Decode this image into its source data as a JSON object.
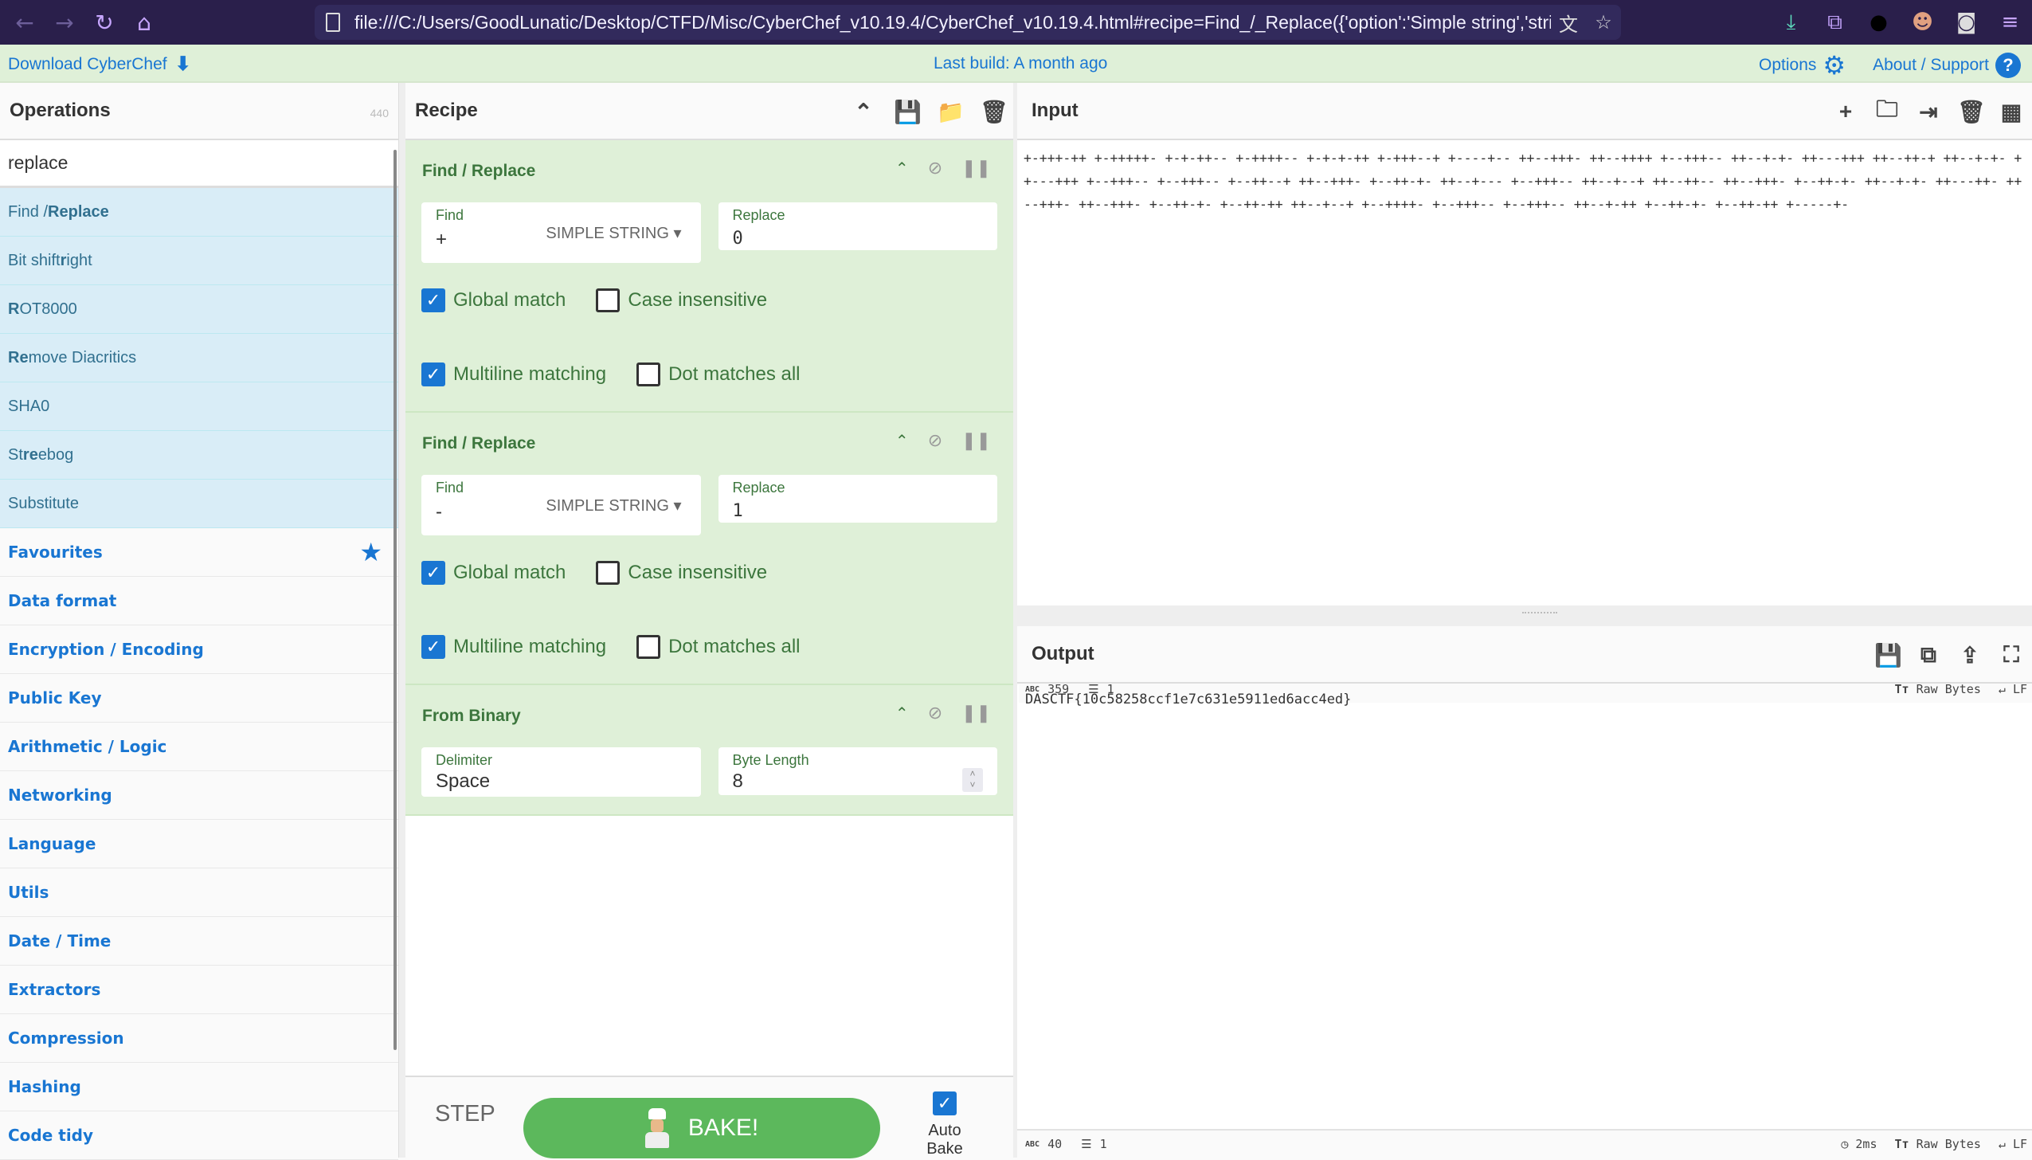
{
  "browser": {
    "url": "file:///C:/Users/GoodLunatic/Desktop/CTFD/Misc/CyberChef_v10.19.4/CyberChef_v10.19.4.html#recipe=Find_/_Replace({'option':'Simple string','string':'%",
    "back_icon": "arrow-left-icon",
    "forward_icon": "arrow-right-icon",
    "reload_icon": "reload-icon",
    "home_icon": "home-icon",
    "translate_icon": "translate-icon",
    "bookmark_icon": "star-outline-icon"
  },
  "banner": {
    "download_label": "Download CyberChef",
    "last_build": "Last build: A month ago",
    "options_label": "Options",
    "about_label": "About / Support"
  },
  "operations": {
    "title": "Operations",
    "count": "440",
    "search_value": "replace",
    "results": [
      {
        "pre": "Find / ",
        "bold": "Replace",
        "post": ""
      },
      {
        "pre": "Bit shift ",
        "bold": "r",
        "post": "ight"
      },
      {
        "pre": "",
        "bold": "R",
        "post": "OT8000"
      },
      {
        "pre": "",
        "bold": "Re",
        "post": "move Diacritics"
      },
      {
        "pre": "SHA0",
        "bold": "",
        "post": ""
      },
      {
        "pre": "St",
        "bold": "re",
        "post": "ebog"
      },
      {
        "pre": "Substitute",
        "bold": "",
        "post": ""
      }
    ],
    "categories": [
      "Favourites",
      "Data format",
      "Encryption / Encoding",
      "Public Key",
      "Arithmetic / Logic",
      "Networking",
      "Language",
      "Utils",
      "Date / Time",
      "Extractors",
      "Compression",
      "Hashing",
      "Code tidy"
    ]
  },
  "recipe": {
    "title": "Recipe",
    "ops": [
      {
        "name": "Find / Replace",
        "find_label": "Find",
        "find_value": "+",
        "find_type": "SIMPLE STRING",
        "replace_label": "Replace",
        "replace_value": "0",
        "checks": [
          {
            "label": "Global match",
            "checked": true
          },
          {
            "label": "Case insensitive",
            "checked": false
          },
          {
            "label": "Multiline matching",
            "checked": true
          },
          {
            "label": "Dot matches all",
            "checked": false
          }
        ]
      },
      {
        "name": "Find / Replace",
        "find_label": "Find",
        "find_value": "-",
        "find_type": "SIMPLE STRING",
        "replace_label": "Replace",
        "replace_value": "1",
        "checks": [
          {
            "label": "Global match",
            "checked": true
          },
          {
            "label": "Case insensitive",
            "checked": false
          },
          {
            "label": "Multiline matching",
            "checked": true
          },
          {
            "label": "Dot matches all",
            "checked": false
          }
        ]
      },
      {
        "name": "From Binary",
        "delimiter_label": "Delimiter",
        "delimiter_value": "Space",
        "byte_length_label": "Byte Length",
        "byte_length_value": "8"
      }
    ],
    "step_label": "STEP",
    "bake_label": "BAKE!",
    "auto_bake_label": "Auto Bake",
    "auto_bake_checked": true
  },
  "input": {
    "title": "Input",
    "text": "+-+++-++ +-+++++- +-+-++-- +-++++-- +-+-+-++ +-+++--+ +----+-- ++--+++- ++--++++ +--+++-- ++--+-+- ++---+++ ++--++-+ ++--+-+- ++---+++ +--+++-- +--+++-- +--++--+ ++--+++- +--++-+- ++--+--- +--+++-- ++--+--+ ++--++-- ++--+++- +--++-+- ++--+-+- ++---++- ++--+++- ++--+++- +--++-+- +--++-++ ++--+--+ +--++++- +--+++-- +--+++-- ++--+-++ +--++-+- +--++-++ +-----+-",
    "length": "359",
    "lines": "1",
    "encoding": "Raw Bytes",
    "eol": "LF"
  },
  "output": {
    "title": "Output",
    "text": "DASCTF{10c58258ccf1e7c631e5911ed6acc4ed}",
    "length": "40",
    "lines": "1",
    "time": "2ms",
    "encoding": "Raw Bytes",
    "eol": "LF"
  },
  "colors": {
    "banner_bg": "#dff0d8",
    "accent": "#1976d2",
    "op_result_bg": "#d9edf7",
    "recipe_op_bg": "#dff0d8",
    "bake_green": "#5cb85c",
    "browser_bg": "#2a1f4b"
  }
}
